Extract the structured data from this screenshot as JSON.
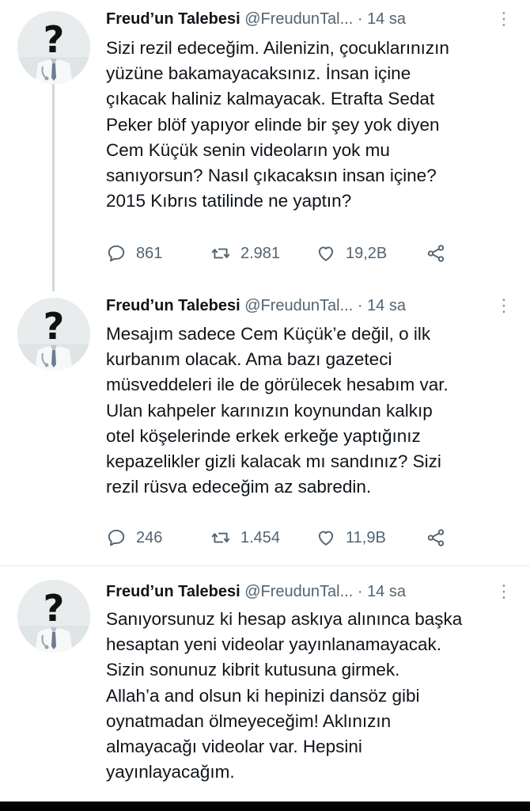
{
  "tweets": [
    {
      "name": "Freud’un Talebesi",
      "handle": "@FreudunTal...",
      "dot": "·",
      "time": "14 sa",
      "text": "Sizi rezil edeceğim. Ailenizin, çocuklarınızın\nyüzüne bakamayacaksınız. İnsan içine\nçıkacak haliniz kalmayacak. Etrafta Sedat\nPeker blöf yapıyor elinde bir şey yok diyen\nCem Küçük senin videoların yok mu\nsanıyorsun? Nasıl çıkacaksın insan içine?\n2015 Kıbrıs tatilinde ne yaptın?",
      "replies": "861",
      "retweets": "2.981",
      "likes": "19,2B"
    },
    {
      "name": "Freud’un Talebesi",
      "handle": "@FreudunTal...",
      "dot": "·",
      "time": "14 sa",
      "text": "Mesajım sadece Cem Küçük’e değil, o ilk\nkurbanım olacak. Ama bazı gazeteci\nmüsveddeleri ile de görülecek hesabım var.\nUlan kahpeler karınızın koynundan kalkıp\notel köşelerinde erkek erkeğe yaptığınız\nkepazelikler gizli kalacak mı sandınız? Sizi\nrezil rüsva edeceğim az sabredin.",
      "replies": "246",
      "retweets": "1.454",
      "likes": "11,9B"
    },
    {
      "name": "Freud’un Talebesi",
      "handle": "@FreudunTal...",
      "dot": "·",
      "time": "14 sa",
      "text": "Sanıyorsunuz ki hesap askıya alınınca başka\nhesaptan yeni videolar yayınlanamayacak.\nSizin sonunuz kibrit kutusuna girmek.\nAllah’a and olsun ki hepinizi dansöz gibi\noynatmadan ölmeyeceğim! Aklınızın\nalmayacağı videolar var. Hepsini\nyayınlayacağım."
    }
  ],
  "icons": {
    "reply": "reply-icon",
    "retweet": "retweet-icon",
    "like": "like-icon",
    "share": "share-icon",
    "more": "more-icon",
    "avatar": "question-mark-doctor-avatar"
  },
  "colors": {
    "text": "#0f1419",
    "muted": "#536471",
    "thread_line": "#cfd9de",
    "separator": "#e6ecf0"
  }
}
